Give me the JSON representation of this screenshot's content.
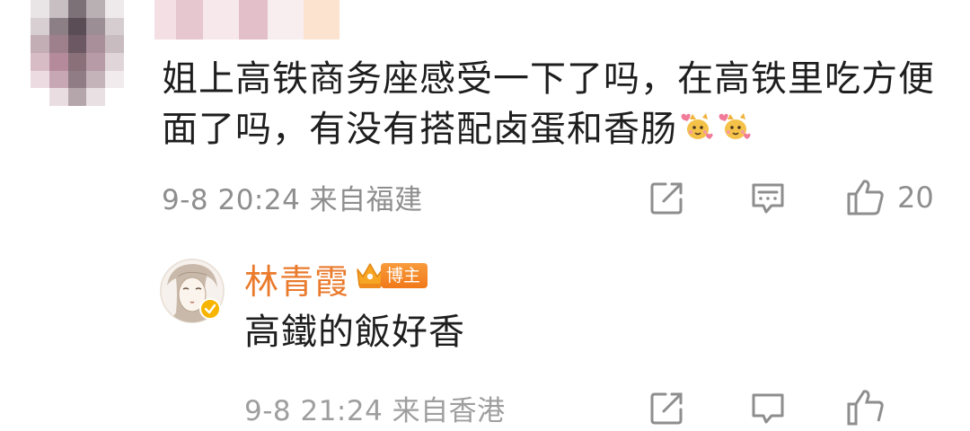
{
  "comment": {
    "text": "姐上高铁商务座感受一下了吗，在高铁里吃方便面了吗，有没有搭配卤蛋和香肠",
    "emoji_icons": [
      "heart-cat-emoji-icon",
      "heart-cat-emoji-icon"
    ],
    "meta": "9-8 20:24  来自福建",
    "like_count": "20"
  },
  "reply": {
    "author": "林青霞",
    "tag": "博主",
    "text": "高鐵的飯好香",
    "meta": "9-8 21:24  来自香港"
  },
  "icons": {
    "share": "share-icon",
    "reply": "comment-icon",
    "like": "thumbs-up-icon",
    "badge": "verified-badge-icon",
    "crown": "crown-icon"
  },
  "colors": {
    "accent_name": "#ea7a2c",
    "tag_bg": "#f1791a",
    "meta_gray": "#8e8e8e",
    "text": "#1e1e1e"
  }
}
